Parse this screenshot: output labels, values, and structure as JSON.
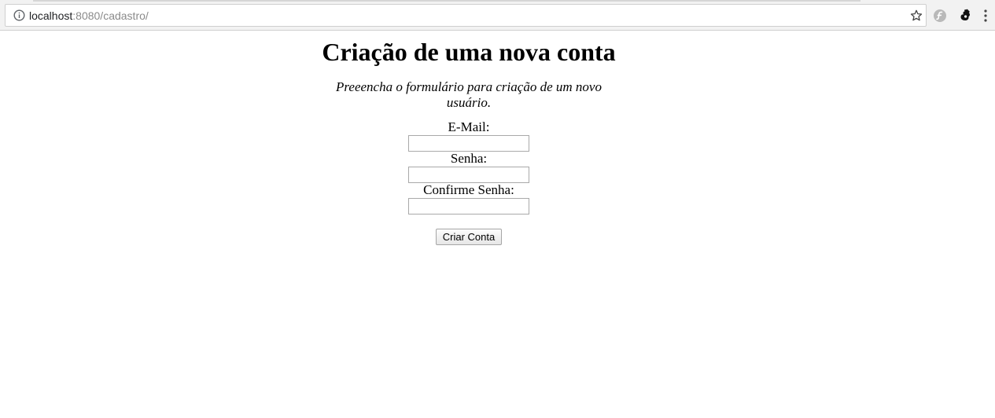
{
  "browser": {
    "url_host": "localhost",
    "url_rest": ":8080/cadastro/",
    "icons": {
      "info": "info-icon",
      "bookmark": "star-icon",
      "extension_1": "extension-icon",
      "extension_2": "extension-icon",
      "menu": "kebab-menu-icon"
    }
  },
  "page": {
    "title": "Criação de uma nova conta",
    "subtitle": "Preeencha o formulário para criação de um novo usuário."
  },
  "form": {
    "email_label": "E-Mail:",
    "email_value": "",
    "password_label": "Senha:",
    "password_value": "",
    "confirm_label": "Confirme Senha:",
    "confirm_value": "",
    "submit_label": "Criar Conta"
  }
}
